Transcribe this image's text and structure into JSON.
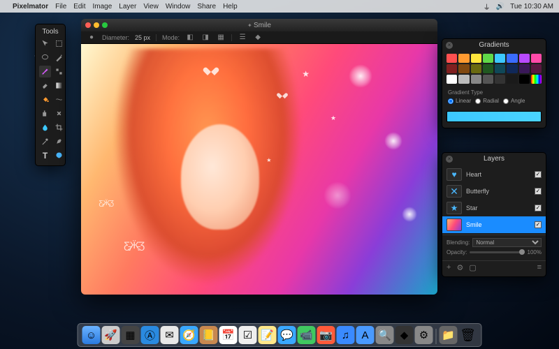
{
  "menubar": {
    "app": "Pixelmator",
    "items": [
      "File",
      "Edit",
      "Image",
      "Layer",
      "View",
      "Window",
      "Share",
      "Help"
    ],
    "clock": "Tue 10:30 AM"
  },
  "tools": {
    "title": "Tools"
  },
  "document": {
    "title": "Smile",
    "toolbar": {
      "diameter_label": "Diameter:",
      "diameter_value": "25 px",
      "mode_label": "Mode:"
    }
  },
  "gradients": {
    "title": "Gradients",
    "type_label": "Gradient Type",
    "options": {
      "linear": "Linear",
      "radial": "Radial",
      "angle": "Angle"
    },
    "swatches": [
      "#ff5050",
      "#ff9a30",
      "#ffe63c",
      "#60d848",
      "#3cc8ff",
      "#3a6cff",
      "#b84aff",
      "#ff4aa8",
      "#802020",
      "#804810",
      "#6a6a10",
      "#205820",
      "#104858",
      "#102858",
      "#3a1858",
      "#581840",
      "#ffffff",
      "#bbbbbb",
      "#888888",
      "#555555",
      "#333333",
      "#1a1a1a",
      "#000000",
      "linear-gradient(90deg,#f00,#ff0,#0f0,#0ff,#00f,#f0f)"
    ]
  },
  "layers": {
    "title": "Layers",
    "items": [
      {
        "name": "Heart",
        "icon": "heart"
      },
      {
        "name": "Butterfly",
        "icon": "butterfly"
      },
      {
        "name": "Star",
        "icon": "star"
      },
      {
        "name": "Smile",
        "icon": "photo",
        "selected": true
      }
    ],
    "blending_label": "Blending:",
    "blending_value": "Normal",
    "opacity_label": "Opacity:",
    "opacity_value": "100%"
  }
}
